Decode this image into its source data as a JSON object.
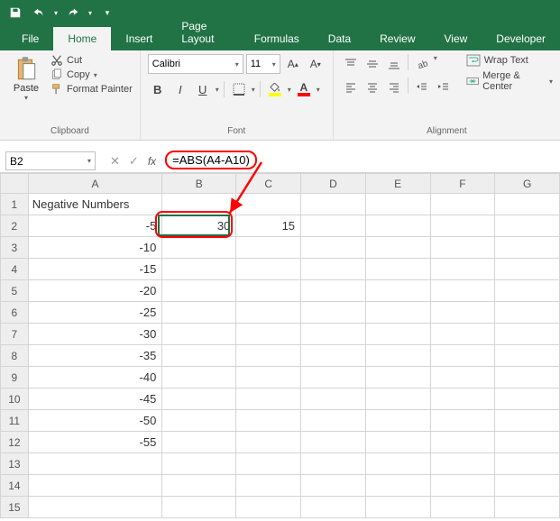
{
  "qat": {
    "save": "save-icon",
    "undo": "undo-icon",
    "redo": "redo-icon"
  },
  "tabs": [
    "File",
    "Home",
    "Insert",
    "Page Layout",
    "Formulas",
    "Data",
    "Review",
    "View",
    "Developer"
  ],
  "active_tab": "Home",
  "ribbon": {
    "clipboard": {
      "label": "Clipboard",
      "paste": "Paste",
      "cut": "Cut",
      "copy": "Copy",
      "format_painter": "Format Painter"
    },
    "font": {
      "label": "Font",
      "name": "Calibri",
      "size": "11",
      "bold": "B",
      "italic": "I",
      "underline": "U"
    },
    "alignment": {
      "label": "Alignment",
      "wrap": "Wrap Text",
      "merge": "Merge & Center"
    }
  },
  "name_box": "B2",
  "formula": "=ABS(A4-A10)",
  "columns": [
    "A",
    "B",
    "C",
    "D",
    "E",
    "F",
    "G"
  ],
  "rows": [
    {
      "n": "1",
      "A": "Negative Numbers",
      "B": "",
      "C": ""
    },
    {
      "n": "2",
      "A": "-5",
      "B": "30",
      "C": "15"
    },
    {
      "n": "3",
      "A": "-10",
      "B": "",
      "C": ""
    },
    {
      "n": "4",
      "A": "-15",
      "B": "",
      "C": ""
    },
    {
      "n": "5",
      "A": "-20",
      "B": "",
      "C": ""
    },
    {
      "n": "6",
      "A": "-25",
      "B": "",
      "C": ""
    },
    {
      "n": "7",
      "A": "-30",
      "B": "",
      "C": ""
    },
    {
      "n": "8",
      "A": "-35",
      "B": "",
      "C": ""
    },
    {
      "n": "9",
      "A": "-40",
      "B": "",
      "C": ""
    },
    {
      "n": "10",
      "A": "-45",
      "B": "",
      "C": ""
    },
    {
      "n": "11",
      "A": "-50",
      "B": "",
      "C": ""
    },
    {
      "n": "12",
      "A": "-55",
      "B": "",
      "C": ""
    },
    {
      "n": "13",
      "A": "",
      "B": "",
      "C": ""
    },
    {
      "n": "14",
      "A": "",
      "B": "",
      "C": ""
    },
    {
      "n": "15",
      "A": "",
      "B": "",
      "C": ""
    }
  ],
  "active_cell": "B2"
}
